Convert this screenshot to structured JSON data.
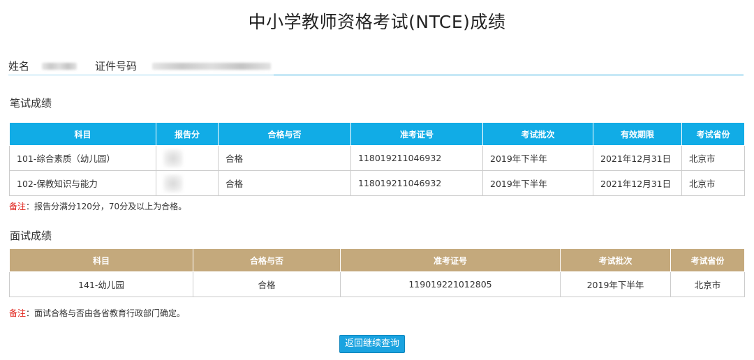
{
  "page": {
    "title": "中小学教师资格考试(NTCE)成绩"
  },
  "identity": {
    "name_label": "姓名",
    "id_label": "证件号码"
  },
  "written": {
    "section_title": "笔试成绩",
    "headers": [
      "科目",
      "报告分",
      "合格与否",
      "准考证号",
      "考试批次",
      "有效期限",
      "考试省份"
    ],
    "rows": [
      {
        "subject": "101-综合素质（幼儿园）",
        "result": "合格",
        "ticket": "118019211046932",
        "batch": "2019年下半年",
        "valid": "2021年12月31日",
        "province": "北京市"
      },
      {
        "subject": "102-保教知识与能力",
        "result": "合格",
        "ticket": "118019211046932",
        "batch": "2019年下半年",
        "valid": "2021年12月31日",
        "province": "北京市"
      }
    ],
    "note_label": "备注",
    "note_text": "：报告分满分120分，70分及以上为合格。"
  },
  "interview": {
    "section_title": "面试成绩",
    "headers": [
      "科目",
      "合格与否",
      "准考证号",
      "考试批次",
      "考试省份"
    ],
    "rows": [
      {
        "subject": "141-幼儿园",
        "result": "合格",
        "ticket": "119019221012805",
        "batch": "2019年下半年",
        "province": "北京市"
      }
    ],
    "note_label": "备注",
    "note_text": "：面试合格与否由各省教育行政部门确定。"
  },
  "actions": {
    "back_label": "返回继续查询"
  },
  "colors": {
    "written_header": "#11ace6",
    "interview_header": "#c4a97c",
    "note_label": "#e0231b",
    "button": "#1aa3e0"
  }
}
